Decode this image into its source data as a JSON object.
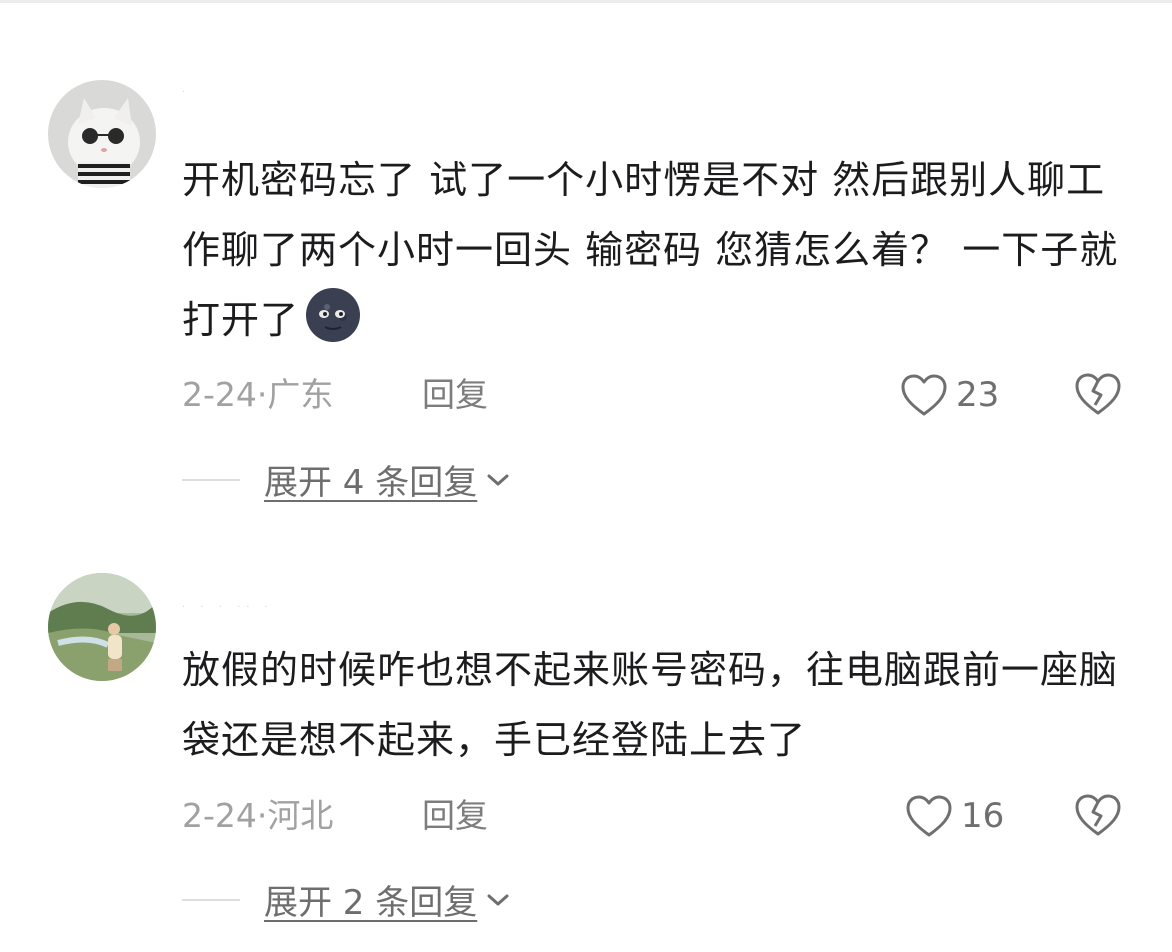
{
  "comments": [
    {
      "username": "·",
      "text": "开机密码忘了 试了一个小时愣是不对   然后跟别人聊工作聊了两个小时一回头 输密码 您猜怎么着？ 一下子就打开了",
      "emoji": "new-moon-face-icon",
      "date": "2-24",
      "location": "广东",
      "reply_label": "回复",
      "likes": "23",
      "expand_label": "展开 4 条回复"
    },
    {
      "username": "· ·  ·  ·· ·",
      "text": "放假的时候咋也想不起来账号密码，往电脑跟前一座脑袋还是想不起来，手已经登陆上去了",
      "date": "2-24",
      "location": "河北",
      "reply_label": "回复",
      "likes": "16",
      "expand_label": "展开 2 条回复"
    }
  ],
  "colors": {
    "text": "#1c1c1e",
    "meta": "#a1a1a1",
    "icon": "#6f6f6f",
    "divider": "#dedede"
  }
}
